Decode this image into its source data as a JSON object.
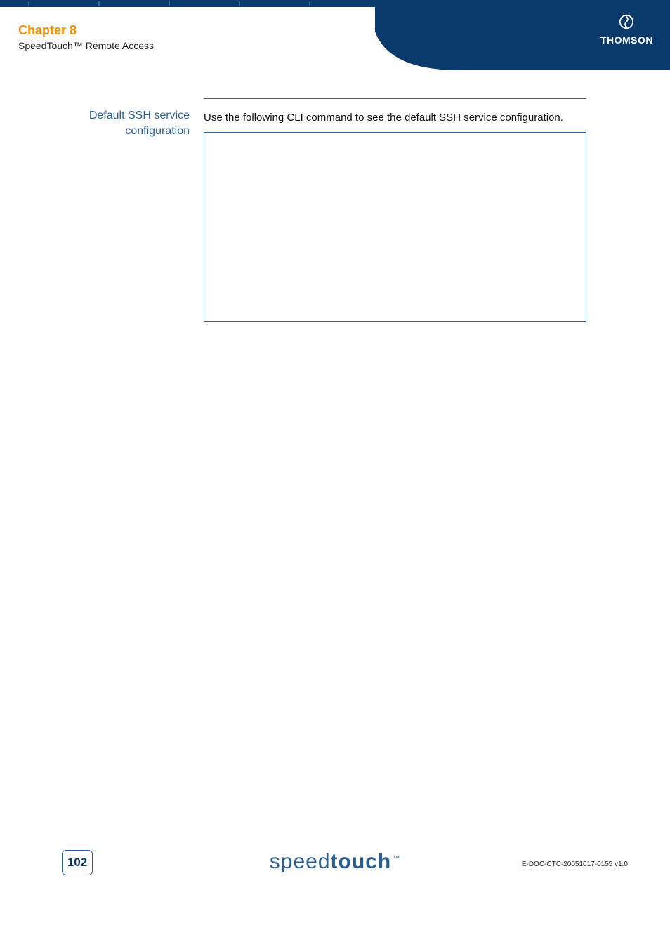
{
  "header": {
    "chapter_title": "Chapter 8",
    "chapter_subtitle": "SpeedTouch™ Remote Access",
    "vendor": "THOMSON"
  },
  "content": {
    "side_heading": "Default SSH service configuration",
    "body": "Use the following CLI command to see the default SSH service configuration."
  },
  "footer": {
    "page_number": "102",
    "brand_light": "speed",
    "brand_bold": "touch",
    "brand_tm": "™",
    "doc_id": "E-DOC-CTC-20051017-0155 v1.0"
  },
  "colors": {
    "navy": "#0b3a6c",
    "brand_blue": "#2a5f93",
    "orange": "#f28c00"
  }
}
